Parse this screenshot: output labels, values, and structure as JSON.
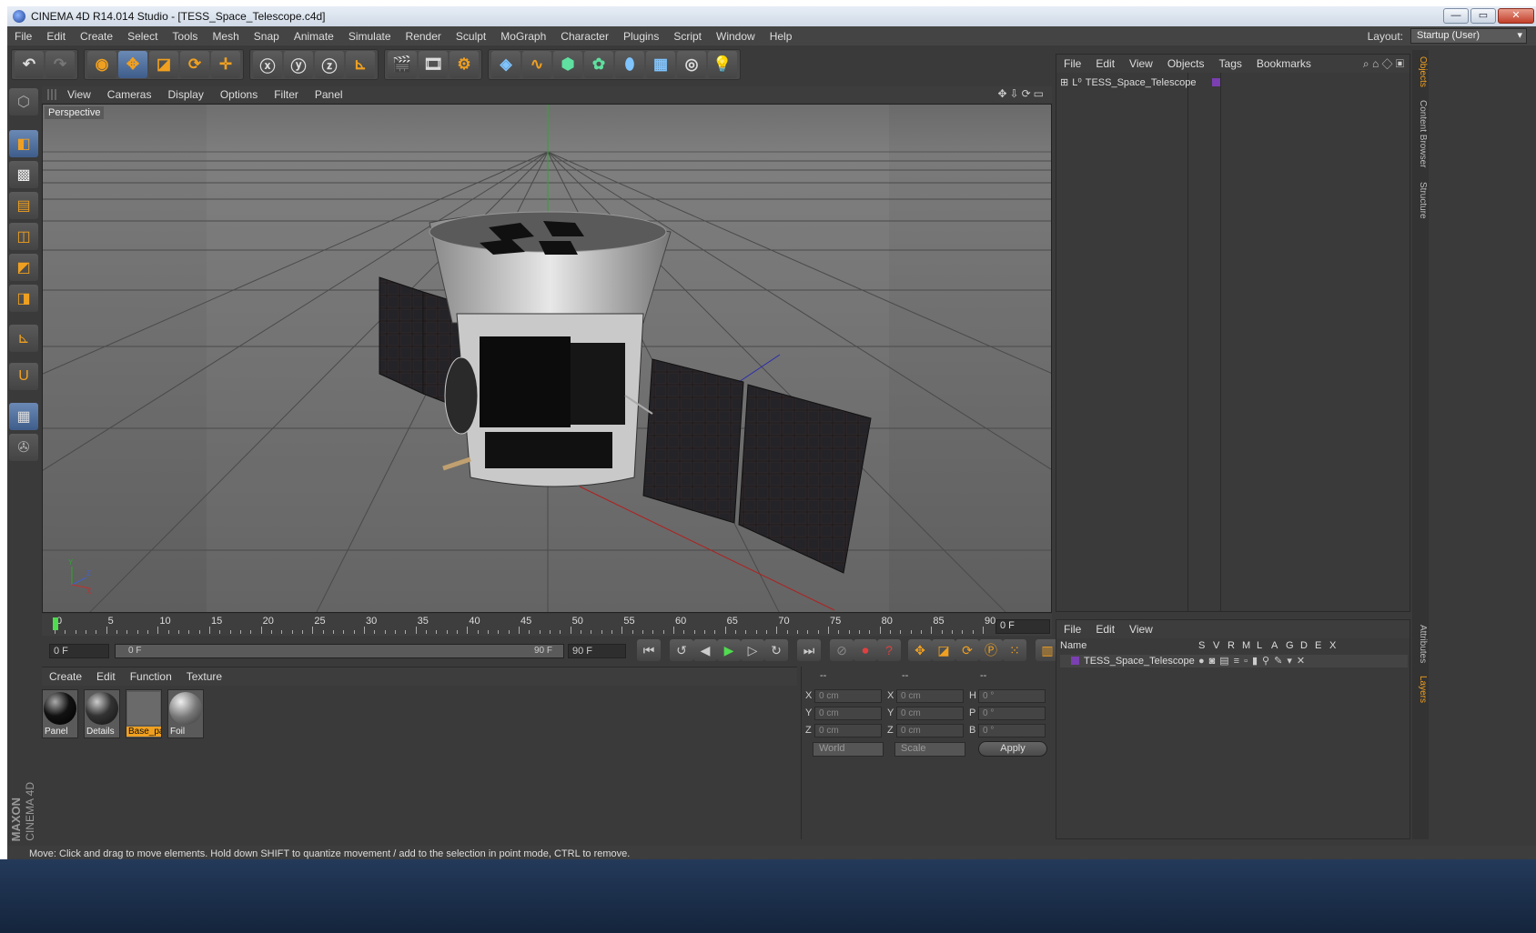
{
  "window": {
    "title": "CINEMA 4D R14.014 Studio - [TESS_Space_Telescope.c4d]",
    "btn_min": "—",
    "btn_max": "▭",
    "btn_close": "✕"
  },
  "menubar": [
    "File",
    "Edit",
    "Create",
    "Select",
    "Tools",
    "Mesh",
    "Snap",
    "Animate",
    "Simulate",
    "Render",
    "Sculpt",
    "MoGraph",
    "Character",
    "Plugins",
    "Script",
    "Window",
    "Help"
  ],
  "layout": {
    "label": "Layout:",
    "value": "Startup (User)"
  },
  "viewport": {
    "menu": [
      "View",
      "Cameras",
      "Display",
      "Options",
      "Filter",
      "Panel"
    ],
    "label": "Perspective",
    "nav_icons": "✥⇩⟳▭"
  },
  "timeline": {
    "ticks": [
      "0",
      "5",
      "10",
      "15",
      "20",
      "25",
      "30",
      "35",
      "40",
      "45",
      "50",
      "55",
      "60",
      "65",
      "70",
      "75",
      "80",
      "85",
      "90"
    ],
    "current_frame": "0 F"
  },
  "transport": {
    "start": "0 F",
    "slider_start": "0 F",
    "slider_end": "90 F",
    "end": "90 F"
  },
  "materials": {
    "menu": [
      "Create",
      "Edit",
      "Function",
      "Texture"
    ],
    "items": [
      {
        "name": "Panel"
      },
      {
        "name": "Details"
      },
      {
        "name": "Base_pa"
      },
      {
        "name": "Foil"
      }
    ]
  },
  "coords": {
    "headers": [
      "--",
      "--",
      "--"
    ],
    "rows": [
      {
        "l1": "X",
        "v1": "0 cm",
        "l2": "X",
        "v2": "0 cm",
        "l3": "H",
        "v3": "0 °"
      },
      {
        "l1": "Y",
        "v1": "0 cm",
        "l2": "Y",
        "v2": "0 cm",
        "l3": "P",
        "v3": "0 °"
      },
      {
        "l1": "Z",
        "v1": "0 cm",
        "l2": "Z",
        "v2": "0 cm",
        "l3": "B",
        "v3": "0 °"
      }
    ],
    "space": "World",
    "mode": "Scale",
    "apply": "Apply"
  },
  "objects": {
    "menu": [
      "File",
      "Edit",
      "View",
      "Objects",
      "Tags",
      "Bookmarks"
    ],
    "item": "TESS_Space_Telescope"
  },
  "layers": {
    "menu": [
      "File",
      "Edit",
      "View"
    ],
    "col_name": "Name",
    "cols": [
      "S",
      "V",
      "R",
      "M",
      "L",
      "A",
      "G",
      "D",
      "E",
      "X"
    ],
    "item": "TESS_Space_Telescope"
  },
  "sidetabs": [
    "Objects",
    "Content Browser",
    "Structure",
    "Attributes",
    "Layers"
  ],
  "brand": {
    "line1": "MAXON",
    "line2": "CINEMA 4D"
  },
  "status": "Move: Click and drag to move elements. Hold down SHIFT to quantize movement / add to the selection in point mode, CTRL to remove.",
  "colors": {
    "accent": "#f0a020",
    "bg": "#3a3a3a",
    "viewport": "#6e6e6e",
    "layer_color": "#7a3fb0"
  }
}
